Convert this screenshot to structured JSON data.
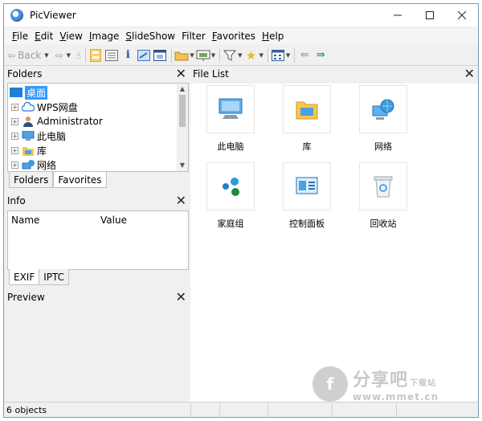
{
  "window": {
    "title": "PicViewer"
  },
  "menu": [
    {
      "key": "F",
      "rest": "ile"
    },
    {
      "key": "E",
      "rest": "dit"
    },
    {
      "key": "V",
      "rest": "iew"
    },
    {
      "key": "I",
      "rest": "mage"
    },
    {
      "key": "S",
      "rest": "lideShow"
    },
    {
      "key": "F",
      "rest": "ilter",
      "plain": "Filter"
    },
    {
      "key": "F",
      "rest": "avorites"
    },
    {
      "key": "H",
      "rest": "elp"
    }
  ],
  "toolbar": {
    "back_label": "Back"
  },
  "folders": {
    "title": "Folders",
    "items": [
      {
        "label": "桌面",
        "icon": "desktop-icon"
      },
      {
        "label": "WPS网盘",
        "icon": "cloud-icon"
      },
      {
        "label": "Administrator",
        "icon": "user-icon"
      },
      {
        "label": "此电脑",
        "icon": "computer-icon"
      },
      {
        "label": "库",
        "icon": "library-icon"
      },
      {
        "label": "网络",
        "icon": "network-icon"
      }
    ],
    "tabs": [
      "Folders",
      "Favorites"
    ]
  },
  "info": {
    "title": "Info",
    "columns": [
      "Name",
      "Value"
    ],
    "tabs": [
      "EXIF",
      "IPTC"
    ]
  },
  "preview": {
    "title": "Preview"
  },
  "file_list": {
    "title": "File List",
    "items": [
      {
        "label": "此电脑",
        "icon": "computer-icon"
      },
      {
        "label": "库",
        "icon": "library-icon"
      },
      {
        "label": "网络",
        "icon": "network-icon"
      },
      {
        "label": "家庭组",
        "icon": "homegroup-icon"
      },
      {
        "label": "控制面板",
        "icon": "control-panel-icon"
      },
      {
        "label": "回收站",
        "icon": "recycle-bin-icon"
      }
    ]
  },
  "status": {
    "objects": "6 objects"
  },
  "watermark": {
    "main": "分享吧",
    "sub": "下载站",
    "url": "www.mmet.cn"
  }
}
